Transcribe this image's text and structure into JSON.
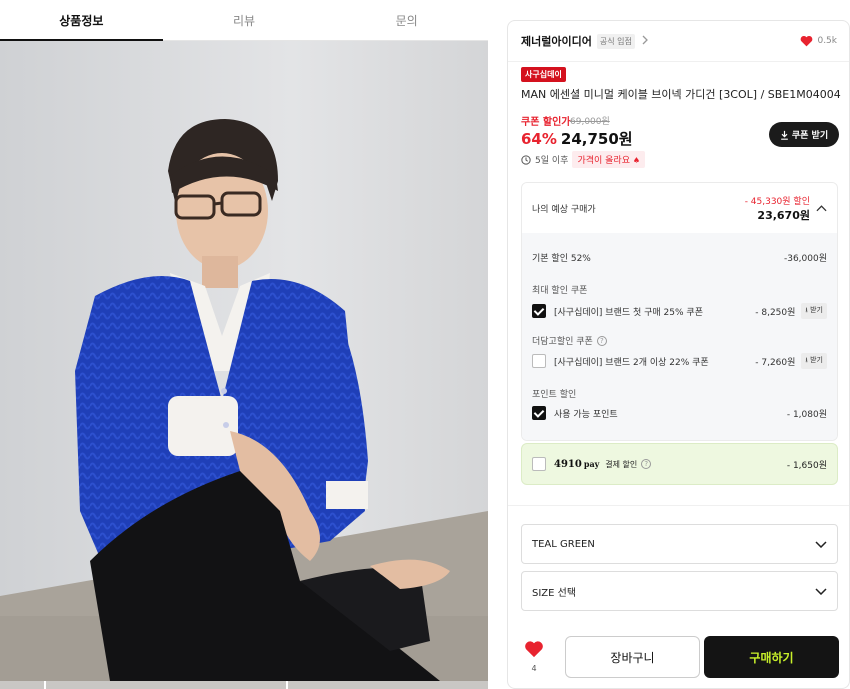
{
  "tabs": [
    {
      "label": "상품정보",
      "active": true
    },
    {
      "label": "리뷰",
      "active": false
    },
    {
      "label": "문의",
      "active": false
    }
  ],
  "brand": {
    "name": "제너럴아이디어",
    "badge": "공식 입점",
    "likes": "0.5k"
  },
  "product": {
    "event_badge": "사구십데이",
    "name": "MAN 에센셜 미니멀 케이블 브이넥 가디건 [3COL] / SBE1M04004",
    "coupon_label": "쿠폰 할인가",
    "original_price": "69,000원",
    "discount": "64%",
    "final_price": "24,750원",
    "coupon_button": "쿠폰 받기",
    "notice_days": "5일 이후",
    "notice_chip": "가격이 올라요"
  },
  "estimate": {
    "title": "나의 예상 구매가",
    "saving": "- 45,330원 할인",
    "price": "23,670원",
    "base_label": "기본 할인 52%",
    "base_amount": "-36,000원",
    "max_coupon_label": "최대 할인 쿠폰",
    "coupon1_label": "[사구십데이] 브랜드 첫 구매 25% 쿠폰",
    "coupon1_amount": "- 8,250원",
    "coupon1_btn": "받기",
    "extra_coupon_label": "더담고할인 쿠폰",
    "coupon2_label": "[사구십데이] 브랜드 2개 이상 22% 쿠폰",
    "coupon2_amount": "- 7,260원",
    "coupon2_btn": "받기",
    "point_section": "포인트 할인",
    "point_label": "사용 가능 포인트",
    "point_amount": "- 1,080원"
  },
  "pay": {
    "logo": "4910",
    "logo_suffix": "pay",
    "label": "결제 할인",
    "amount": "- 1,650원"
  },
  "options": {
    "color": "TEAL GREEN",
    "size": "SIZE 선택"
  },
  "actions": {
    "like_count": "4",
    "cart": "장바구니",
    "buy": "구매하기"
  },
  "colors": {
    "accent_red": "#e8232f",
    "buy_text": "#c8f02a",
    "dark": "#141414"
  }
}
